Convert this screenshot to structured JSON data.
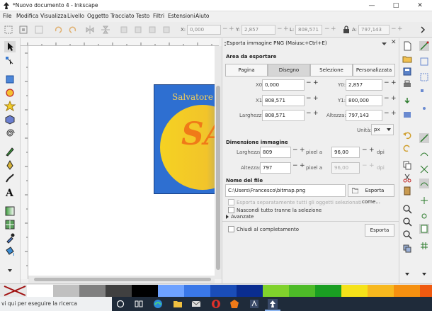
{
  "window": {
    "title": "*Nuovo documento 4 - Inkscape",
    "minimize": "—",
    "maximize": "□",
    "close": "✕"
  },
  "menu": [
    "File",
    "Modifica",
    "Visualizza",
    "Livello",
    "Oggetto",
    "Tracciato",
    "Testo",
    "Filtri",
    "Estensioni",
    "Aiuto"
  ],
  "toolbar": {
    "x_label": "X:",
    "x_value": "0,000",
    "y_label": "Y:",
    "y_value": "2,857",
    "l_label": "L:",
    "l_value": "808,571",
    "a_label": "A:",
    "a_value": "797,143"
  },
  "canvas": {
    "text": "Salvatore Ar",
    "initials": "SA",
    "colors": {
      "page_bg": "#2e6fd1",
      "circle_from": "#f5d222",
      "circle_to": "#3c6ed0",
      "text_orange": "#f07a18"
    }
  },
  "export": {
    "panel_title": "Esporta immagine PNG (Maiusc+Ctrl+E)",
    "area_section": "Area da esportare",
    "tabs": [
      "Pagina",
      "Disegno",
      "Selezione",
      "Personalizzata"
    ],
    "active_tab": "Disegno",
    "x0_label": "X0:",
    "x0_value": "0,000",
    "y0_label": "Y0:",
    "y0_value": "2,857",
    "x1_label": "X1:",
    "x1_value": "808,571",
    "y1_label": "Y1:",
    "y1_value": "800,000",
    "width_label": "Larghezza:",
    "width_value": "808,571",
    "height_label": "Altezza:",
    "height_value": "797,143",
    "units_label": "Unità:",
    "units_value": "px",
    "dim_section": "Dimensione immagine",
    "img_width_label": "Larghezza:",
    "img_width_value": "809",
    "img_height_label": "Altezza:",
    "img_height_value": "797",
    "pixel_at": "pixel a",
    "dpi_value": "96,00",
    "dpi_value_disabled": "96,00",
    "dpi_label": "dpi",
    "filename_section": "Nome del file",
    "filename_value": "C:\\Users\\Francesco\\bitmap.png",
    "export_as": "Esporta come...",
    "opt_batch": "Esporta separatamente tutti gli oggetti selezionati",
    "opt_hide": "Nascondi tutto tranne la selezione",
    "advanced": "Avanzate",
    "close_when_done": "Chiudi al completamento",
    "export_button": "Esporta"
  },
  "palette": [
    "#ffffff",
    "#c0c0c0",
    "#808080",
    "#404040",
    "#000000",
    "#6ea2ff",
    "#3a78e8",
    "#1a4db8",
    "#0a2d90",
    "#80d22c",
    "#4dbb28",
    "#1a9e22",
    "#f5e21a",
    "#f7b81e",
    "#f59010",
    "#ef5a10",
    "#e02a14"
  ],
  "taskbar": {
    "search": "vi qui per eseguire la ricerca"
  }
}
